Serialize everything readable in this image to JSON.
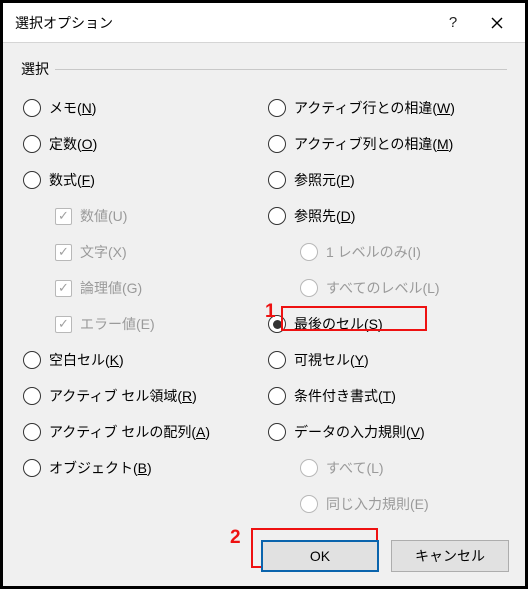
{
  "titlebar": {
    "title": "選択オプション"
  },
  "group": {
    "legend": "選択"
  },
  "left": {
    "memo": {
      "pre": "メモ(",
      "u": "N",
      "post": ")"
    },
    "const": {
      "pre": "定数(",
      "u": "O",
      "post": ")"
    },
    "formula": {
      "pre": "数式(",
      "u": "F",
      "post": ")"
    },
    "num": {
      "text": "数値(U)"
    },
    "text": {
      "text": "文字(X)"
    },
    "logic": {
      "text": "論理値(G)"
    },
    "error": {
      "text": "エラー値(E)"
    },
    "blank": {
      "pre": "空白セル(",
      "u": "K",
      "post": ")"
    },
    "region": {
      "pre": "アクティブ セル領域(",
      "u": "R",
      "post": ")"
    },
    "array": {
      "pre": "アクティブ セルの配列(",
      "u": "A",
      "post": ")"
    },
    "object": {
      "pre": "オブジェクト(",
      "u": "B",
      "post": ")"
    }
  },
  "right": {
    "rowdiff": {
      "pre": "アクティブ行との相違(",
      "u": "W",
      "post": ")"
    },
    "coldiff": {
      "pre": "アクティブ列との相違(",
      "u": "M",
      "post": ")"
    },
    "precsrc": {
      "pre": "参照元(",
      "u": "P",
      "post": ")"
    },
    "depdst": {
      "pre": "参照先(",
      "u": "D",
      "post": ")"
    },
    "lvl1": {
      "text": "1 レベルのみ(I)"
    },
    "alllvl": {
      "text": "すべてのレベル(L)"
    },
    "lastcell": {
      "pre": "最後のセル(",
      "u": "S",
      "post": ")"
    },
    "visible": {
      "pre": "可視セル(",
      "u": "Y",
      "post": ")"
    },
    "condfmt": {
      "pre": "条件付き書式(",
      "u": "T",
      "post": ")"
    },
    "validation": {
      "pre": "データの入力規則(",
      "u": "V",
      "post": ")"
    },
    "all": {
      "text": "すべて(L)"
    },
    "same": {
      "text": "同じ入力規則(E)"
    }
  },
  "markers": {
    "m1": "1",
    "m2": "2"
  },
  "buttons": {
    "ok": "OK",
    "cancel": "キャンセル"
  }
}
